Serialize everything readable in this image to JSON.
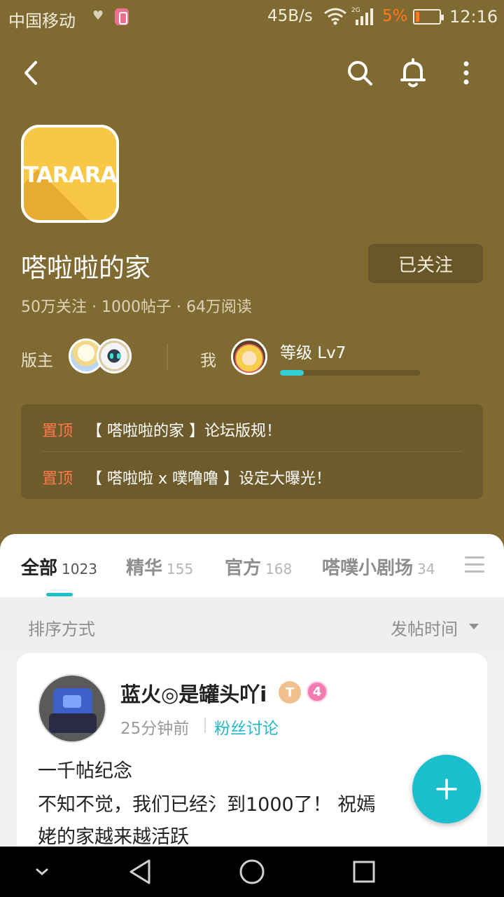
{
  "status_bar": {
    "carrier": "中国移动",
    "net_speed": "45B/s",
    "network_type": "2G",
    "battery_percent": "5%",
    "time": "12:16"
  },
  "toolbar": {
    "icons": [
      "back-icon",
      "search-icon",
      "bell-icon",
      "more-vertical-icon"
    ]
  },
  "forum": {
    "logo_text": "TARARA",
    "name": "嗒啦啦的家",
    "follow_label": "已关注",
    "stats": "50万关注 · 1000帖子 · 64万阅读",
    "moderator_label": "版主",
    "me_label": "我",
    "level_text": "等级 Lv7",
    "level_progress": 0.17
  },
  "pinned": [
    {
      "tag": "置顶",
      "title": "【 嗒啦啦的家 】论坛版规！"
    },
    {
      "tag": "置顶",
      "title": "【 嗒啦啦 x 噗噜噜 】设定大曝光！"
    }
  ],
  "tabs": [
    {
      "label": "全部",
      "count": "1023",
      "active": true
    },
    {
      "label": "精华",
      "count": "155"
    },
    {
      "label": "官方",
      "count": "168"
    },
    {
      "label": "嗒噗小剧场",
      "count": "34"
    }
  ],
  "sort": {
    "label": "排序方式",
    "value": "发帖时间"
  },
  "post": {
    "author": "蓝火◎是罐头吖i",
    "badge_t": "T",
    "badge_level": "4",
    "time": "25分钟前",
    "category": "粉丝讨论",
    "title": "一千帖纪念",
    "body_line1": "不知不觉，我们已经氵到1000了！ 祝嫣",
    "body_line2": "姥的家越来越活跃"
  },
  "colors": {
    "header_bg": "#7f6a32",
    "accent": "#1bbecc",
    "pin_tag": "#ff7a4d"
  }
}
